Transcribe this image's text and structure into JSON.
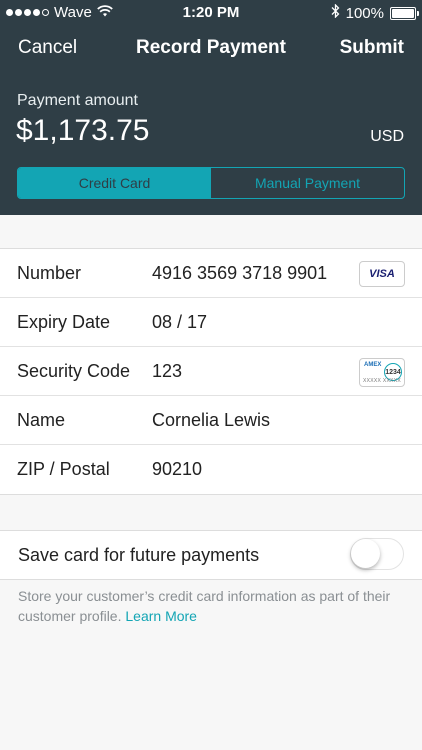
{
  "status_bar": {
    "carrier": "Wave",
    "time": "1:20 PM",
    "battery": "100%",
    "signal_bars": 4,
    "signal_total": 5
  },
  "nav": {
    "cancel": "Cancel",
    "title": "Record Payment",
    "submit": "Submit"
  },
  "payment": {
    "amount_label": "Payment amount",
    "amount": "$1,173.75",
    "currency": "USD"
  },
  "payment_method": {
    "selected": "Credit Card",
    "options": [
      "Credit Card",
      "Manual Payment"
    ]
  },
  "card_form": {
    "rows": [
      {
        "label": "Number",
        "value": "4916 3569 3718 9901"
      },
      {
        "label": "Expiry Date",
        "value": "08 / 17"
      },
      {
        "label": "Security Code",
        "value": "123"
      },
      {
        "label": "Name",
        "value": "Cornelia Lewis"
      },
      {
        "label": "ZIP / Postal",
        "value": "90210"
      }
    ],
    "visa_badge": "VISA",
    "amex_badge": {
      "brand": "AMEX",
      "code": "1234",
      "mask": "XXXXX XXXXX"
    }
  },
  "save_card": {
    "label": "Save card for future payments",
    "enabled": false
  },
  "footnote": {
    "text": "Store your customer’s credit card information as part of their customer profile. ",
    "link": "Learn More"
  },
  "colors": {
    "header_bg": "#2f3e46",
    "accent": "#13a5b4",
    "page_bg": "#f7f7f7"
  },
  "icons": [
    "wifi-icon",
    "bluetooth-icon",
    "battery-icon",
    "visa-card-icon",
    "amex-cvv-icon"
  ]
}
